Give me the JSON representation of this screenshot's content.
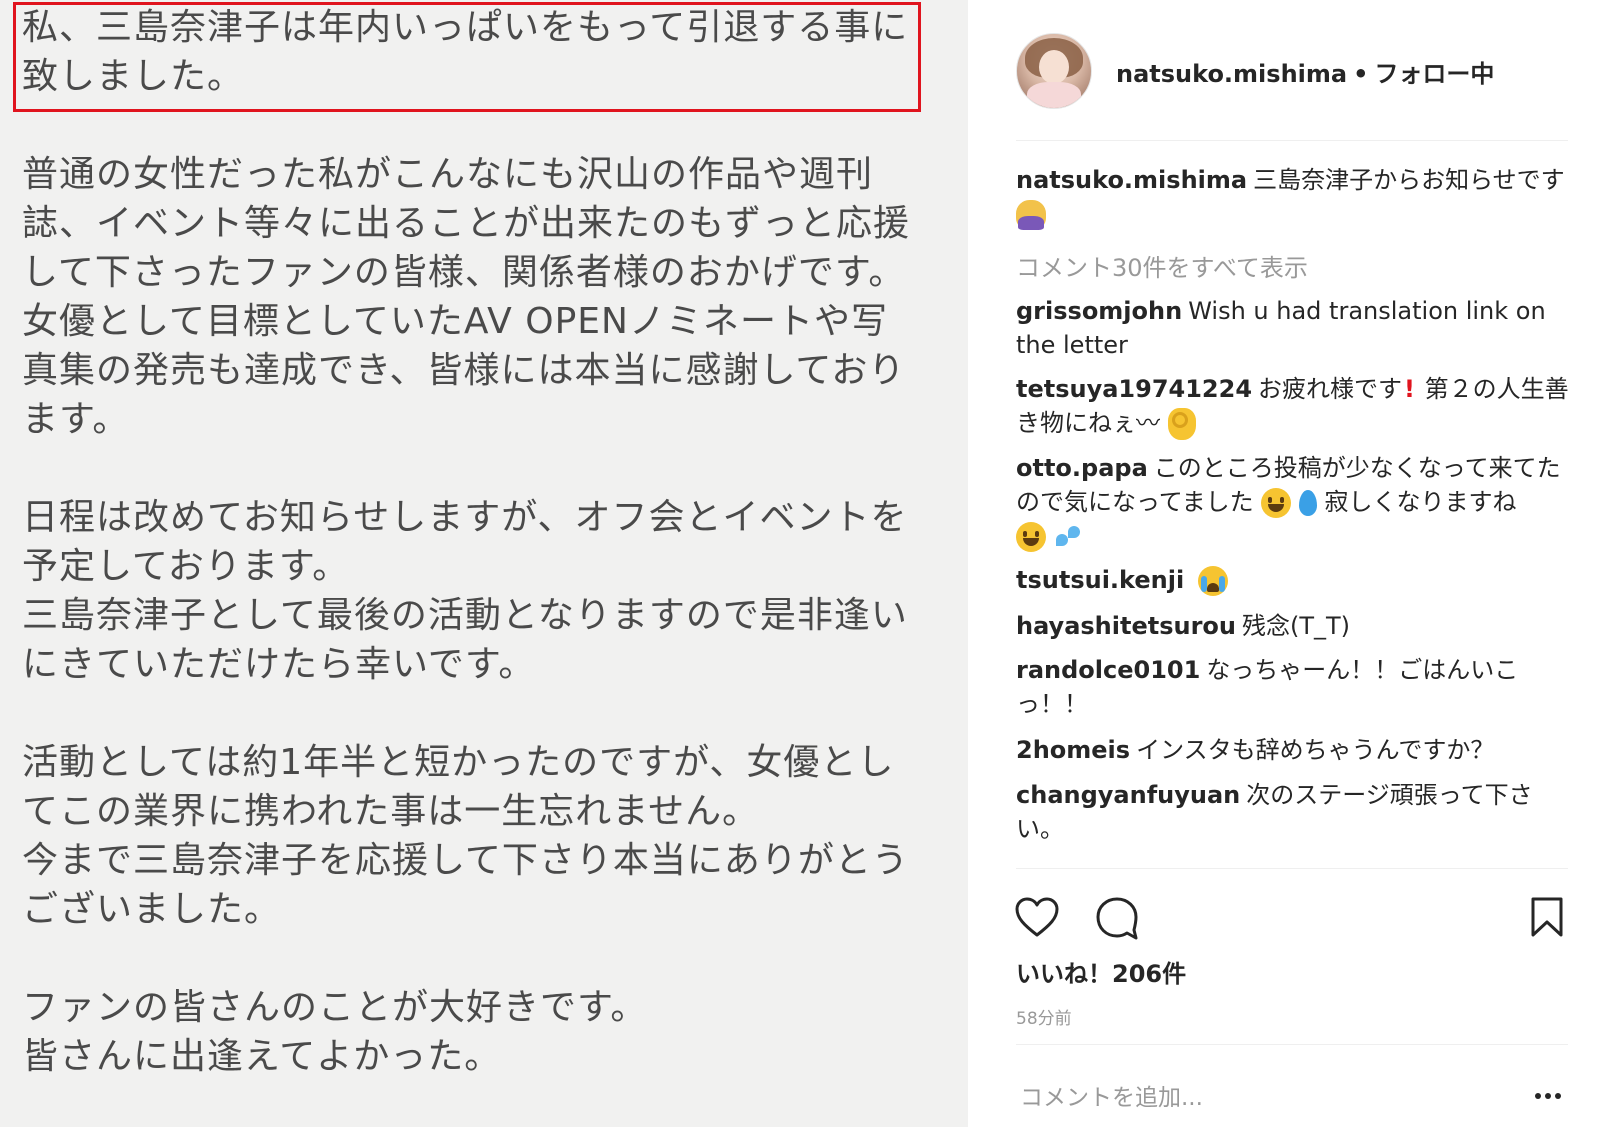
{
  "letter": {
    "lines": [
      "私、三島奈津子は年内いっぱいをもって引退する事に",
      "致しました。",
      "普通の女性だった私がこんなにも沢山の作品や週刊",
      "誌、イベント等々に出ることが出来たのもずっと応援",
      "して下さったファンの皆様、関係者様のおかげです。",
      "女優として目標としていたAV OPENノミネートや写",
      "真集の発売も達成でき、皆様には本当に感謝しており",
      "ます。",
      "日程は改めてお知らせしますが、オフ会とイベントを",
      "予定しております。",
      "三島奈津子として最後の活動となりますので是非逢い",
      "にきていただけたら幸いです。",
      "活動としては約1年半と短かったのですが、女優とし",
      "てこの業界に携われた事は一生忘れません。",
      "今まで三島奈津子を応援して下さり本当にありがとう",
      "ございました。",
      "ファンの皆さんのことが大好きです。",
      "皆さんに出逢えてよかった。"
    ]
  },
  "post": {
    "username": "natsuko.mishima",
    "separator": "•",
    "follow_status": "フォロー中",
    "caption_user": "natsuko.mishima",
    "caption_text": "三島奈津子からお知らせです",
    "view_all_comments": "コメント30件をすべて表示",
    "comments": [
      {
        "user": "grissomjohn",
        "text": "Wish u had translation link on the letter"
      },
      {
        "user": "tetsuya19741224",
        "text_a": "お疲れ様です",
        "text_b": " 第２の人生善き物にねぇ〰"
      },
      {
        "user": "otto.papa",
        "text_a": "このところ投稿が少なくなって来てたので気になってました",
        "text_b": " 寂しくなりますね"
      },
      {
        "user": "tsutsui.kenji",
        "text": ""
      },
      {
        "user": "hayashitetsurou",
        "text": "残念(T_T)"
      },
      {
        "user": "randolce0101",
        "text": "なっちゃーん！！ごはんいこっ！！"
      },
      {
        "user": "2homeis",
        "text": "インスタも辞めちゃうんですか？"
      },
      {
        "user": "changyanfuyuan",
        "text": "次のステージ頑張って下さい。"
      }
    ],
    "likes": "いいね！206件",
    "timestamp": "58分前",
    "comment_placeholder": "コメントを追加...",
    "icons": {
      "like": "heart-icon",
      "comment": "comment-bubble-icon",
      "save": "bookmark-icon",
      "more": "more-options-icon"
    },
    "colors": {
      "highlight_border": "#e0141e",
      "meta_gray": "#999999",
      "text": "#262626",
      "letter_bg": "#f1f1f0"
    }
  }
}
